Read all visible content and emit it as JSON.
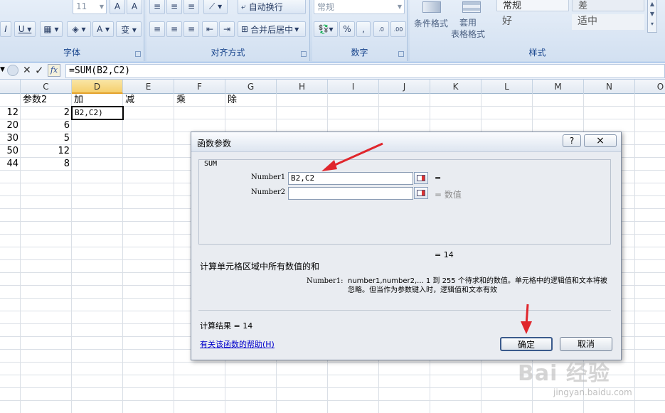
{
  "ribbon": {
    "font_size": "11",
    "align_wrap": "自动换行",
    "align_merge": "合并后居中",
    "number_format": "常规",
    "cond_format": "条件格式",
    "table_format": "套用\n表格格式",
    "styles": [
      "常规",
      "差",
      "好",
      "适中"
    ],
    "group_font": "字体",
    "group_align": "对齐方式",
    "group_number": "数字",
    "group_styles": "样式"
  },
  "formula_bar": {
    "formula": "=SUM(B2,C2)"
  },
  "columns": [
    "C",
    "D",
    "E",
    "F",
    "G",
    "H",
    "I",
    "J",
    "K",
    "L",
    "M",
    "N",
    "O"
  ],
  "sheet": {
    "header_row": [
      "参数2",
      "加",
      "减",
      "乘",
      "除"
    ],
    "col_b_partial": [
      "12",
      "20",
      "30",
      "50",
      "44"
    ],
    "col_c": [
      "2",
      "6",
      "5",
      "12",
      "8"
    ],
    "active_cell_value": "B2,C2)"
  },
  "dialog": {
    "title": "函数参数",
    "help_icon": "?",
    "close_icon": "×",
    "function_name": "SUM",
    "arg1_label": "Number1",
    "arg1_value": "B2,C2",
    "arg1_result": "=",
    "arg2_label": "Number2",
    "arg2_value": "",
    "arg2_result": "= 数值",
    "total": "= 14",
    "description": "计算单元格区域中所有数值的和",
    "arg_help_label": "Number1:",
    "arg_help_text": "number1,number2,... 1 到 255 个待求和的数值。单元格中的逻辑值和文本将被忽略。但当作为参数键入时，逻辑值和文本有效",
    "result_label": "计算结果 = 14",
    "help_link": "有关该函数的帮助(H)",
    "ok_button": "确定",
    "cancel_button": "取消"
  },
  "watermark": {
    "brand": "Bai 经验",
    "url": "jingyan.baidu.com"
  },
  "colors": {
    "ribbon_label": "#15428b",
    "arrow": "#e0262c",
    "link": "#0000cc",
    "selection": "#f5cf6d"
  }
}
